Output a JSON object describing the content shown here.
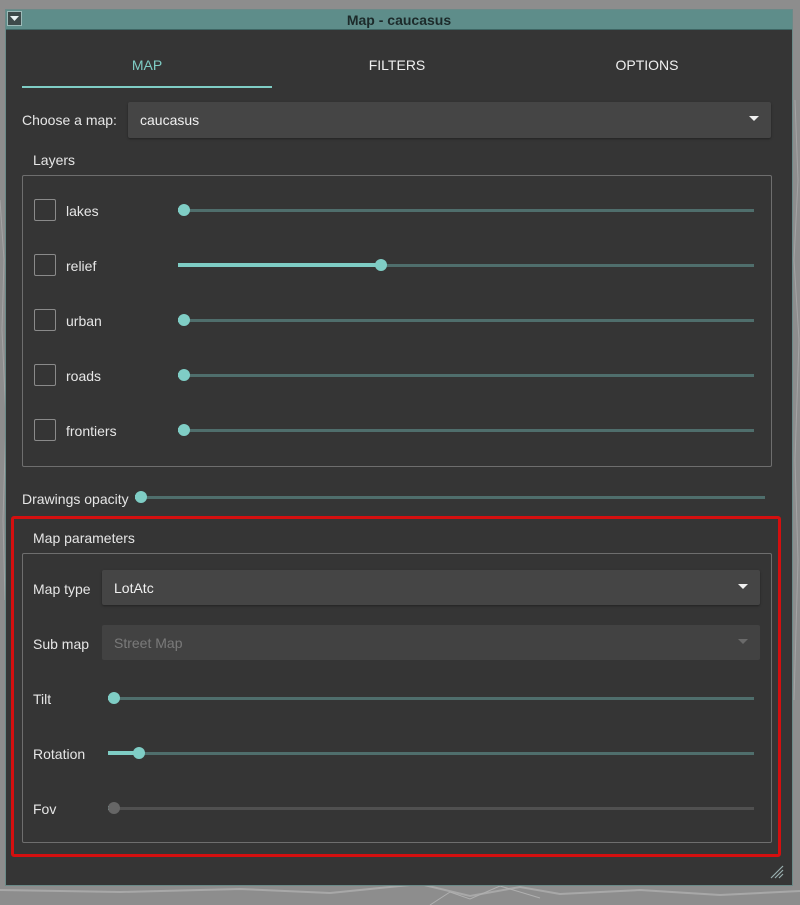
{
  "window": {
    "title": "Map - caucasus"
  },
  "tabs": [
    {
      "label": "MAP",
      "active": true
    },
    {
      "label": "FILTERS",
      "active": false
    },
    {
      "label": "OPTIONS",
      "active": false
    }
  ],
  "map_select": {
    "label": "Choose a map:",
    "value": "caucasus"
  },
  "layers": {
    "title": "Layers",
    "items": [
      {
        "label": "lakes",
        "checked": false,
        "slider_fraction": 0.0
      },
      {
        "label": "relief",
        "checked": false,
        "slider_fraction": 0.35
      },
      {
        "label": "urban",
        "checked": false,
        "slider_fraction": 0.0
      },
      {
        "label": "roads",
        "checked": false,
        "slider_fraction": 0.0
      },
      {
        "label": "frontiers",
        "checked": false,
        "slider_fraction": 0.0
      }
    ]
  },
  "drawings_opacity": {
    "label": "Drawings opacity",
    "fraction": 0.0
  },
  "map_parameters": {
    "title": "Map parameters",
    "map_type": {
      "label": "Map type",
      "value": "LotAtc"
    },
    "sub_map": {
      "label": "Sub map",
      "value": "Street Map",
      "disabled": true
    },
    "tilt": {
      "label": "Tilt",
      "fraction": 0.0
    },
    "rotation": {
      "label": "Rotation",
      "fraction": 0.04
    },
    "fov": {
      "label": "Fov",
      "fraction": 0.0,
      "disabled": true
    }
  },
  "colors": {
    "accent": "#7fcdc5",
    "window_bg": "#353535",
    "titlebar": "#5e8d8a",
    "highlight_border": "#d40f0f"
  }
}
